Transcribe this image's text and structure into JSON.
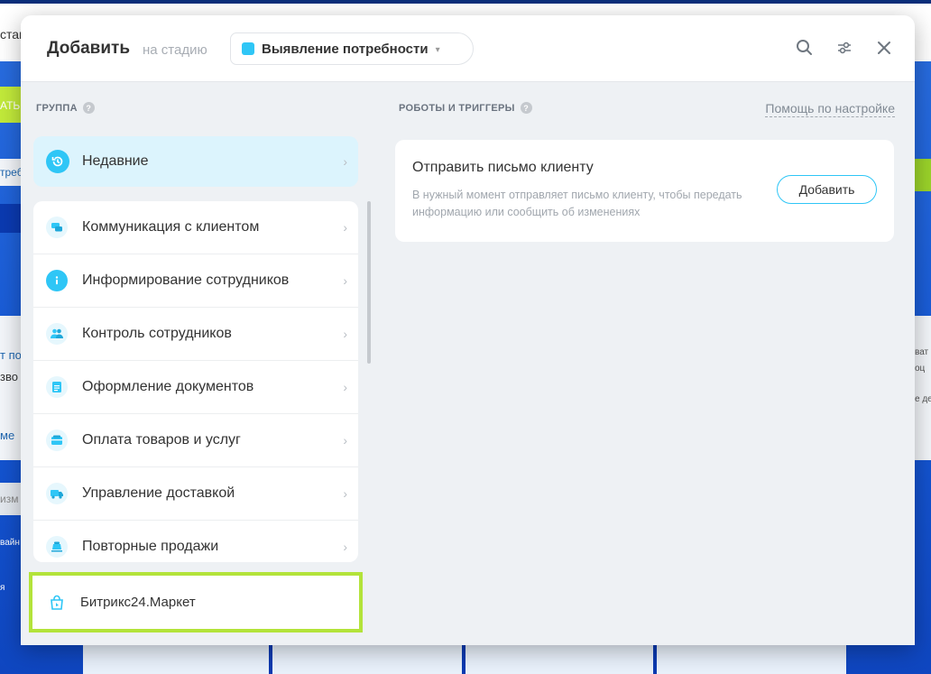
{
  "background": {
    "fragments": [
      "стан",
      "АТЬ",
      "треб",
      "т по",
      "зво",
      "ме",
      "изм",
      "вайн",
      "я",
      "ват",
      "оц",
      "е де"
    ]
  },
  "header": {
    "title": "Добавить",
    "subtitle": "на стадию",
    "stage_label": "Выявление потребности",
    "stage_color": "#2fc6f6"
  },
  "left": {
    "section_title": "ГРУППА",
    "recent": {
      "label": "Недавние",
      "icon": "recent-icon"
    },
    "groups": [
      {
        "label": "Коммуникация с клиентом",
        "icon": "chat-icon"
      },
      {
        "label": "Информирование сотрудников",
        "icon": "info-icon"
      },
      {
        "label": "Контроль сотрудников",
        "icon": "users-icon"
      },
      {
        "label": "Оформление документов",
        "icon": "document-icon"
      },
      {
        "label": "Оплата товаров и услуг",
        "icon": "wallet-icon"
      },
      {
        "label": "Управление доставкой",
        "icon": "truck-icon"
      },
      {
        "label": "Повторные продажи",
        "icon": "repeat-sales-icon"
      }
    ],
    "market": {
      "label": "Битрикс24.Маркет",
      "icon": "market-icon"
    }
  },
  "right": {
    "section_title": "РОБОТЫ И ТРИГГЕРЫ",
    "help_link": "Помощь по настройке",
    "card": {
      "title": "Отправить письмо клиенту",
      "description": "В нужный момент отправляет письмо клиенту, чтобы передать информацию или сообщить об изменениях",
      "button": "Добавить"
    }
  },
  "colors": {
    "accent": "#2fc6f6",
    "market_highlight": "#b3e33a"
  }
}
